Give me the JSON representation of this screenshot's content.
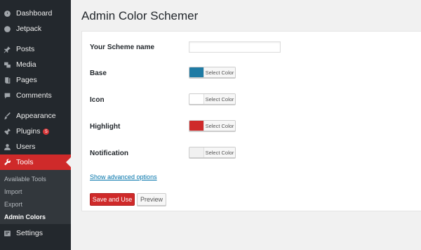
{
  "sidebar": {
    "items": [
      {
        "label": "Dashboard",
        "icon": "dashboard-icon"
      },
      {
        "label": "Jetpack",
        "icon": "jetpack-icon"
      },
      {
        "label": "Posts",
        "icon": "pin-icon"
      },
      {
        "label": "Media",
        "icon": "media-icon"
      },
      {
        "label": "Pages",
        "icon": "pages-icon"
      },
      {
        "label": "Comments",
        "icon": "comments-icon"
      },
      {
        "label": "Appearance",
        "icon": "brush-icon"
      },
      {
        "label": "Plugins",
        "icon": "plugin-icon",
        "badge": "5"
      },
      {
        "label": "Users",
        "icon": "user-icon"
      },
      {
        "label": "Tools",
        "icon": "wrench-icon",
        "active": true
      },
      {
        "label": "Settings",
        "icon": "settings-icon"
      }
    ],
    "submenu": [
      "Available Tools",
      "Import",
      "Export",
      "Admin Colors"
    ]
  },
  "page": {
    "title": "Admin Color Schemer"
  },
  "form": {
    "name_label": "Your Scheme name",
    "name_value": "",
    "select_color_text": "Select Color",
    "fields": [
      {
        "label": "Base",
        "color": "#1f7ba4"
      },
      {
        "label": "Icon",
        "color": "#ffffff"
      },
      {
        "label": "Highlight",
        "color": "#cf2a2a"
      },
      {
        "label": "Notification",
        "color": "#f1f1f1"
      }
    ],
    "advanced_link": "Show advanced options",
    "save_label": "Save and Use",
    "preview_label": "Preview"
  },
  "colors": {
    "sidebar_bg": "#23282d",
    "active_bg": "#cf2a2a",
    "primary_button": "#cf2a2a",
    "link": "#0073aa"
  }
}
